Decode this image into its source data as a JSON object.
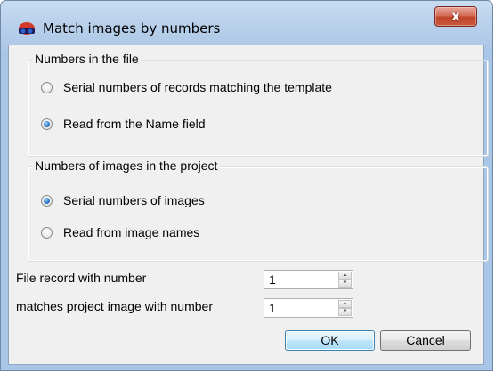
{
  "window": {
    "title": "Match images by numbers",
    "close_label": "x",
    "accent": "#aac6e6"
  },
  "group_file": {
    "title": "Numbers in the file",
    "options": [
      {
        "label": "Serial numbers of records matching the template",
        "checked": false
      },
      {
        "label": "Read from the Name field",
        "checked": true
      }
    ]
  },
  "group_project": {
    "title": "Numbers of images in the project",
    "options": [
      {
        "label": "Serial numbers of images",
        "checked": true
      },
      {
        "label": "Read from image names",
        "checked": false
      }
    ]
  },
  "fields": {
    "file_record_label": "File record with number",
    "file_record_value": "1",
    "project_image_label": "matches project image with number",
    "project_image_value": "1"
  },
  "buttons": {
    "ok": "OK",
    "cancel": "Cancel"
  },
  "icons": {
    "app": "3d-glasses-icon",
    "spin_up": "spin-up-icon",
    "spin_down": "spin-down-icon"
  }
}
